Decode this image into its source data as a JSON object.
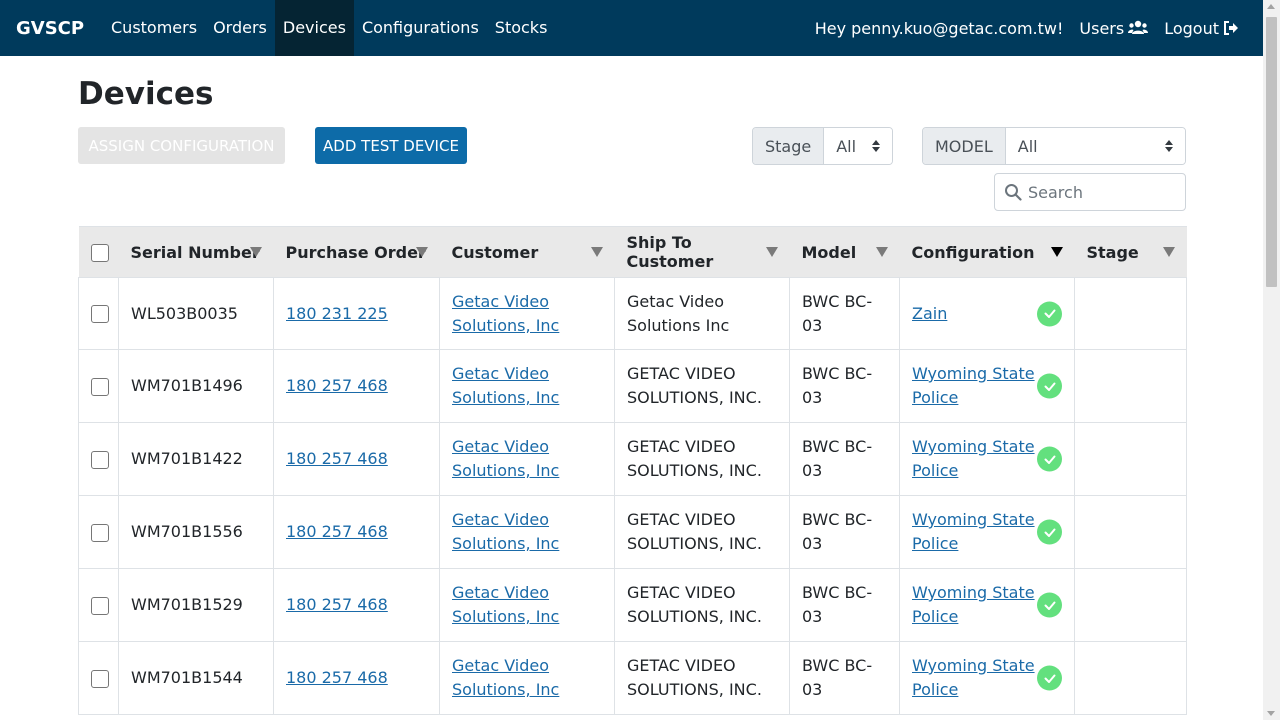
{
  "nav": {
    "brand": "GVSCP",
    "links": [
      {
        "label": "Customers"
      },
      {
        "label": "Orders"
      },
      {
        "label": "Devices",
        "active": true
      },
      {
        "label": "Configurations"
      },
      {
        "label": "Stocks"
      }
    ],
    "greeting": "Hey penny.kuo@getac.com.tw!",
    "users_label": "Users",
    "logout_label": "Logout"
  },
  "page": {
    "title": "Devices",
    "assign_button": "ASSIGN CONFIGURATION",
    "add_button": "ADD TEST DEVICE",
    "stage_filter": {
      "label": "Stage",
      "value": "All"
    },
    "model_filter": {
      "label": "MODEL",
      "value": "All"
    },
    "search_placeholder": "Search"
  },
  "table": {
    "columns": [
      "Serial Number",
      "Purchase Order",
      "Customer",
      "Ship To Customer",
      "Model",
      "Configuration",
      "Stage"
    ],
    "rows": [
      {
        "serial": "WL503B0035",
        "po": "180 231 225",
        "customer": "Getac Video Solutions, Inc",
        "ship_to": "Getac Video Solutions Inc",
        "model": "BWC BC-03",
        "config": "Zain",
        "stage": ""
      },
      {
        "serial": "WM701B1496",
        "po": "180 257 468",
        "customer": "Getac Video Solutions, Inc",
        "ship_to": "GETAC VIDEO SOLUTIONS, INC.",
        "model": "BWC BC-03",
        "config": "Wyoming State Police",
        "stage": ""
      },
      {
        "serial": "WM701B1422",
        "po": "180 257 468",
        "customer": "Getac Video Solutions, Inc",
        "ship_to": "GETAC VIDEO SOLUTIONS, INC.",
        "model": "BWC BC-03",
        "config": "Wyoming State Police",
        "stage": ""
      },
      {
        "serial": "WM701B1556",
        "po": "180 257 468",
        "customer": "Getac Video Solutions, Inc",
        "ship_to": "GETAC VIDEO SOLUTIONS, INC.",
        "model": "BWC BC-03",
        "config": "Wyoming State Police",
        "stage": ""
      },
      {
        "serial": "WM701B1529",
        "po": "180 257 468",
        "customer": "Getac Video Solutions, Inc",
        "ship_to": "GETAC VIDEO SOLUTIONS, INC.",
        "model": "BWC BC-03",
        "config": "Wyoming State Police",
        "stage": ""
      },
      {
        "serial": "WM701B1544",
        "po": "180 257 468",
        "customer": "Getac Video Solutions, Inc",
        "ship_to": "GETAC VIDEO SOLUTIONS, INC.",
        "model": "BWC BC-03",
        "config": "Wyoming State Police",
        "stage": ""
      }
    ]
  },
  "colors": {
    "navbar": "#003a5c",
    "primary_button": "#0d6ba8",
    "link": "#1a6aa8",
    "status_ok": "#63e07e"
  }
}
